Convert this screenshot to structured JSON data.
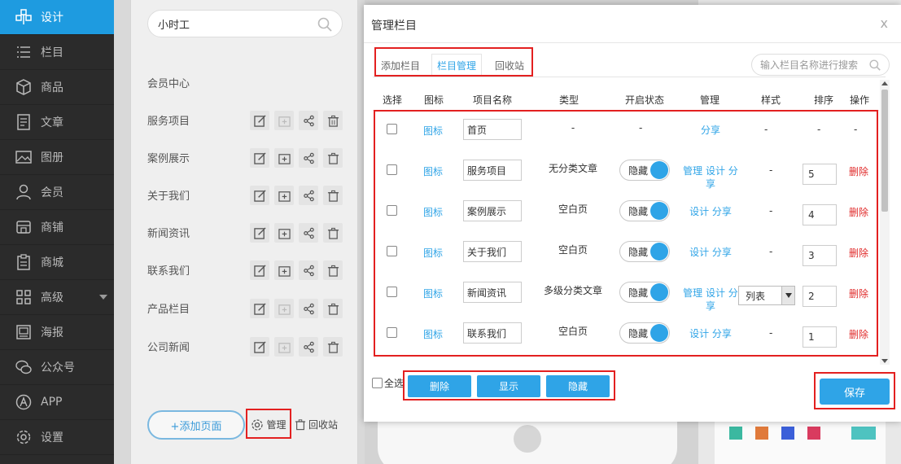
{
  "nav": {
    "items": [
      {
        "label": "设计",
        "icon": "design-icon"
      },
      {
        "label": "栏目",
        "icon": "list-icon"
      },
      {
        "label": "商品",
        "icon": "box-icon"
      },
      {
        "label": "文章",
        "icon": "article-icon"
      },
      {
        "label": "图册",
        "icon": "image-icon"
      },
      {
        "label": "会员",
        "icon": "user-icon"
      },
      {
        "label": "商铺",
        "icon": "shop-icon"
      },
      {
        "label": "商城",
        "icon": "mall-icon"
      },
      {
        "label": "高级",
        "icon": "grid-icon"
      },
      {
        "label": "海报",
        "icon": "poster-icon"
      },
      {
        "label": "公众号",
        "icon": "wechat-icon"
      },
      {
        "label": "APP",
        "icon": "app-icon"
      },
      {
        "label": "设置",
        "icon": "settings-icon"
      }
    ]
  },
  "pages": {
    "search_value": "小时工",
    "items": [
      "会员中心",
      "服务项目",
      "案例展示",
      "关于我们",
      "新闻资讯",
      "联系我们",
      "产品栏目",
      "公司新闻"
    ],
    "add_label": "+添加页面",
    "manage_label": "管理",
    "recycle_label": "回收站"
  },
  "modal": {
    "title": "管理栏目",
    "close": "x",
    "tabs": [
      "添加栏目",
      "栏目管理",
      "回收站"
    ],
    "search_placeholder": "输入栏目名称进行搜索",
    "headers": [
      "选择",
      "图标",
      "项目名称",
      "类型",
      "开启状态",
      "管理",
      "样式",
      "排序",
      "操作"
    ],
    "icon_link": "图标",
    "rows": [
      {
        "name": "首页",
        "type": "-",
        "status": "-",
        "manage": "分享",
        "style": "-",
        "order": "-",
        "action": "-"
      },
      {
        "name": "服务项目",
        "type": "无分类文章",
        "status": "隐藏",
        "manage": "管理 设计 分享",
        "style": "-",
        "order": "5",
        "action": "删除"
      },
      {
        "name": "案例展示",
        "type": "空白页",
        "status": "隐藏",
        "manage": "设计 分享",
        "style": "-",
        "order": "4",
        "action": "删除"
      },
      {
        "name": "关于我们",
        "type": "空白页",
        "status": "隐藏",
        "manage": "设计 分享",
        "style": "-",
        "order": "3",
        "action": "删除"
      },
      {
        "name": "新闻资讯",
        "type": "多级分类文章",
        "status": "隐藏",
        "manage": "管理 设计 分享",
        "style": "列表",
        "order": "2",
        "action": "删除"
      },
      {
        "name": "联系我们",
        "type": "空白页",
        "status": "隐藏",
        "manage": "设计 分享",
        "style": "-",
        "order": "1",
        "action": "删除"
      }
    ],
    "select_all": "全选",
    "buttons": {
      "delete": "删除",
      "show": "显示",
      "hide": "隐藏",
      "save": "保存"
    }
  },
  "colors": {
    "accent": "#2fa4e7",
    "nav_bg": "#2b2b2b",
    "nav_active": "#1e9be0",
    "danger": "#e02b2b",
    "highlight": "#e32020"
  }
}
